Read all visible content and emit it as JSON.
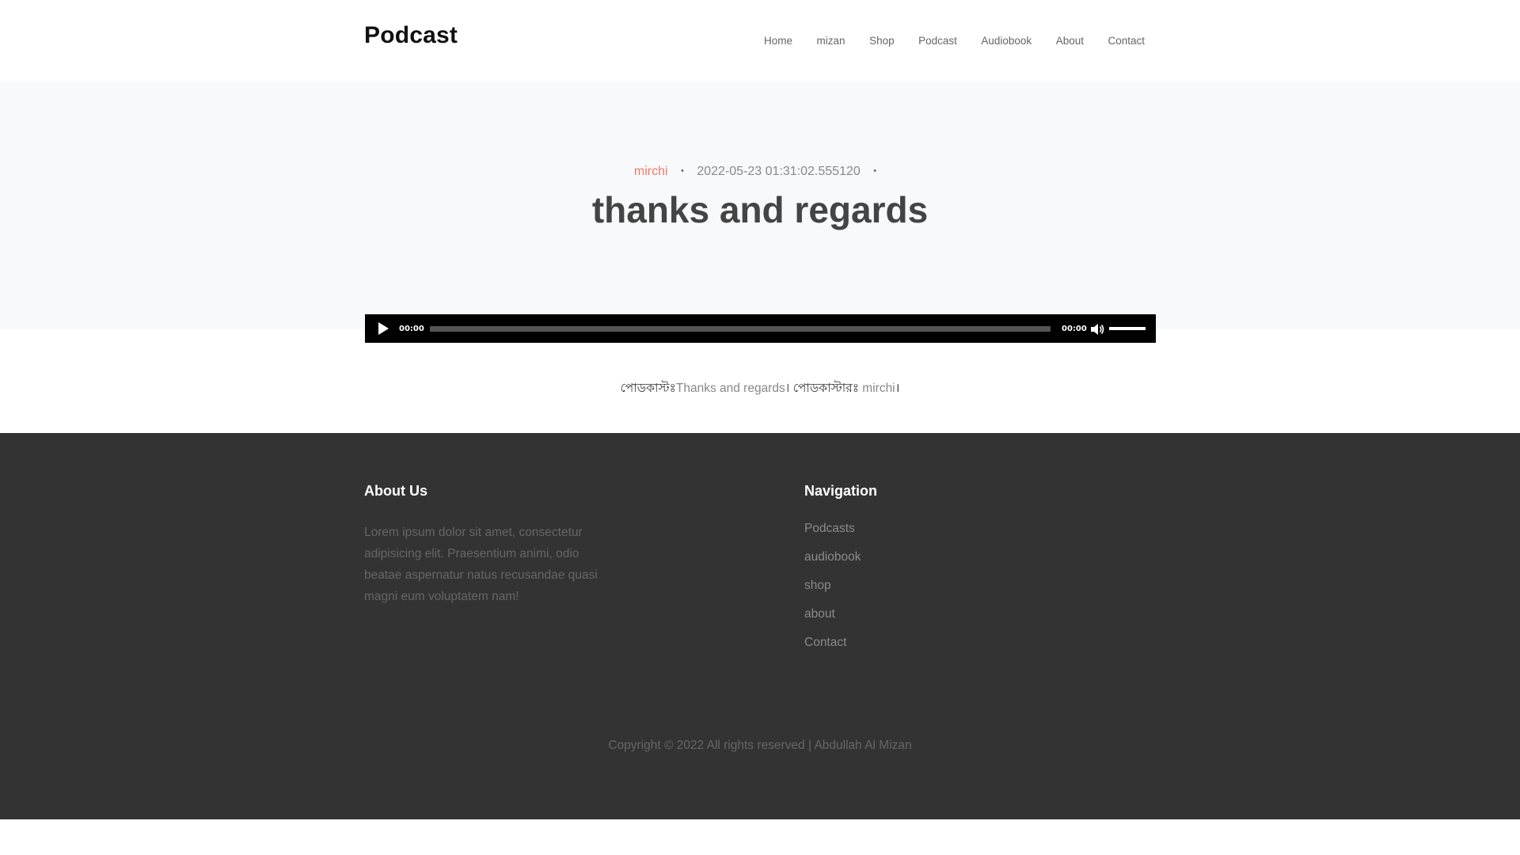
{
  "header": {
    "brand": "Podcast",
    "nav": [
      "Home",
      "mizan",
      "Shop",
      "Podcast",
      "Audiobook",
      "About",
      "Contact"
    ]
  },
  "post": {
    "author": "mirchi",
    "date": "2022-05-23 01:31:02.555120",
    "title": "thanks and regards"
  },
  "player": {
    "current_time": "00:00",
    "duration": "00:00",
    "progress": 0,
    "volume": 1.0
  },
  "description": {
    "label_podcast": "পোডকাস্টঃ",
    "podcast_value": "Thanks and regards",
    "separator": "।",
    "label_podcaster": " পোডকাস্টারঃ ",
    "podcaster_value": "mirchi",
    "end": "।"
  },
  "footer": {
    "about_title": "About Us",
    "about_text": "Lorem ipsum dolor sit amet, consectetur adipisicing elit. Praesentium animi, odio beatae aspernatur natus recusandae quasi magni eum voluptatem nam!",
    "nav_title": "Navigation",
    "links": [
      "Podcasts",
      "audiobook",
      "shop",
      "about",
      "Contact"
    ],
    "copyright": "Copyright © 2022 All rights reserved | Abdullah Al Mizan"
  },
  "colors": {
    "accent": "#f1786a",
    "footer_bg": "#333333",
    "hero_bg": "#f8f9fa",
    "player_bg": "#000000"
  },
  "icons": {
    "play": "play-icon",
    "mute": "volume-icon"
  }
}
